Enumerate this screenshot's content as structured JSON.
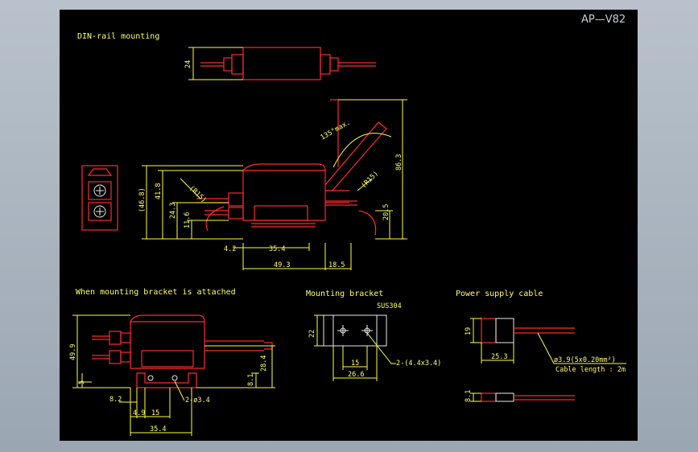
{
  "drawing_code": "AP—V82",
  "views": {
    "din": {
      "title": "DIN-rail mounting",
      "dims": {
        "d24": "24",
        "d135": "135°max.",
        "d86": "86.3",
        "d46": "(46.8)",
        "d41": "41.8",
        "d24b": "24.3",
        "d11": "11.6",
        "r15a": "(R15)",
        "r15b": "(R15)",
        "d20": "20.5",
        "d42": "4.2",
        "d35": "35.4",
        "d49": "49.3",
        "d18": "18.5"
      }
    },
    "bracket_attached": {
      "title": "When mounting bracket is attached",
      "dims": {
        "d49": "49.9",
        "d28": "28.4",
        "d5": "5",
        "d8": "8.1",
        "d82": "8.2",
        "hole": "2-ø3.4",
        "d49b": "4.9",
        "d15": "15",
        "d35": "35.4"
      }
    },
    "mounting_bracket": {
      "title": "Mounting bracket",
      "material": "SUS304",
      "dims": {
        "d22": "22",
        "d15": "15",
        "d26": "26.6",
        "hole": "2-(4.4x3.4)"
      }
    },
    "power_cable": {
      "title": "Power supply cable",
      "dims": {
        "d19": "19",
        "d25": "25.3",
        "d8": "8.1",
        "spec": "ø3.9(5x0.20mm²)",
        "length": "Cable length : 2m"
      }
    }
  },
  "colors": {
    "background": "#000000",
    "dimension": "#ffff3a",
    "outline": "#ff2a2a",
    "frame": "#b9c2cc"
  }
}
